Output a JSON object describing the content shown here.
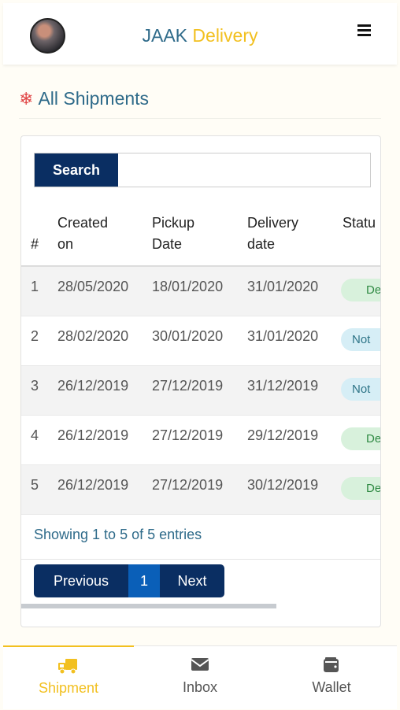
{
  "header": {
    "brand_part1": "JAAK ",
    "brand_part2": "Delivery",
    "avatar_icon": "user-avatar",
    "menu_icon": "hamburger-menu-icon"
  },
  "page": {
    "title": "All Shipments",
    "title_icon": "snowflake-icon"
  },
  "search": {
    "button_label": "Search",
    "input_value": "",
    "placeholder": ""
  },
  "table": {
    "headers": [
      [
        "#"
      ],
      [
        "Created",
        "on"
      ],
      [
        "Pickup",
        "Date"
      ],
      [
        "Delivery",
        "date"
      ],
      [
        "Statu"
      ]
    ],
    "rows": [
      {
        "num": "1",
        "created": "28/05/2020",
        "pickup": "18/01/2020",
        "delivery": "31/01/2020",
        "status": "De",
        "status_color": "#d8f1dc"
      },
      {
        "num": "2",
        "created": "28/02/2020",
        "pickup": "30/01/2020",
        "delivery": "31/01/2020",
        "status": "Not",
        "status_color": "#d6eef6"
      },
      {
        "num": "3",
        "created": "26/12/2019",
        "pickup": "27/12/2019",
        "delivery": "31/12/2019",
        "status": "Not",
        "status_color": "#d6eef6"
      },
      {
        "num": "4",
        "created": "26/12/2019",
        "pickup": "27/12/2019",
        "delivery": "29/12/2019",
        "status": "De",
        "status_color": "#d8f1dc"
      },
      {
        "num": "5",
        "created": "26/12/2019",
        "pickup": "27/12/2019",
        "delivery": "30/12/2019",
        "status": "De",
        "status_color": "#d8f1dc"
      }
    ]
  },
  "info": "Showing 1 to 5 of 5 entries",
  "pagination": {
    "previous": "Previous",
    "page": "1",
    "next": "Next"
  },
  "bottom_nav": [
    {
      "label": "Shipment",
      "icon": "delivery-truck-icon",
      "active": true
    },
    {
      "label": "Inbox",
      "icon": "envelope-icon",
      "active": false
    },
    {
      "label": "Wallet",
      "icon": "wallet-icon",
      "active": false
    }
  ],
  "colors": {
    "brand_blue": "#2f6b8a",
    "brand_yellow": "#f2c020",
    "navy": "#0a2e62",
    "page_active": "#0a5fb8"
  }
}
